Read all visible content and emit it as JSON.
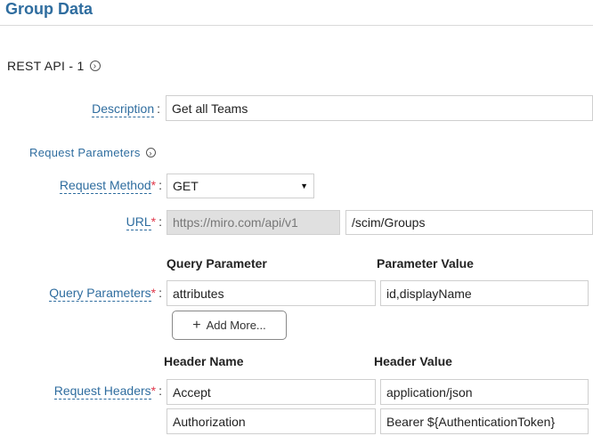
{
  "header": {
    "title": "Group Data"
  },
  "section": {
    "label": "REST API - 1",
    "info_icon": "chevron-circle-right-icon"
  },
  "description": {
    "label": "Description",
    "value": "Get all Teams"
  },
  "request_params": {
    "label": "Request Parameters",
    "info_icon": "chevron-circle-right-icon"
  },
  "method": {
    "label": "Request Method",
    "value": "GET"
  },
  "url": {
    "label": "URL",
    "base": "https://miro.com/api/v1",
    "path": "/scim/Groups"
  },
  "query": {
    "label": "Query Parameters",
    "col_param": "Query Parameter",
    "col_value": "Parameter Value",
    "rows": [
      {
        "param": "attributes",
        "value": "id,displayName"
      }
    ],
    "add_more": "Add More..."
  },
  "headers": {
    "label": "Request Headers",
    "col_name": "Header Name",
    "col_value": "Header Value",
    "rows": [
      {
        "name": "Accept",
        "value": "application/json"
      },
      {
        "name": "Authorization",
        "value": "Bearer ${AuthenticationToken}"
      }
    ]
  },
  "colors": {
    "accent": "#2f6d9f",
    "required": "#e0384b"
  }
}
